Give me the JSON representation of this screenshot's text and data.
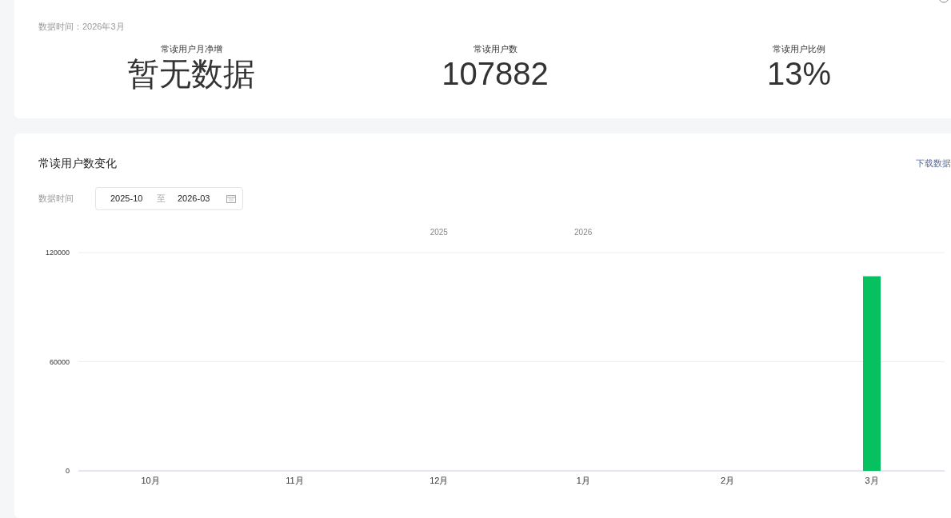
{
  "summary_card": {
    "data_time": "数据时间：2026年3月",
    "metrics": [
      {
        "label": "常读用户月净增",
        "value": "暂无数据"
      },
      {
        "label": "常读用户数",
        "value": "107882"
      },
      {
        "label": "常读用户比例",
        "value": "13%"
      }
    ]
  },
  "trend_card": {
    "title": "常读用户数变化",
    "download_link": "下载数据",
    "date_label": "数据时间",
    "date_start": "2025-10",
    "date_separator": "至",
    "date_end": "2026-03",
    "chart_data": {
      "type": "bar",
      "categories": [
        "10月",
        "11月",
        "12月",
        "1月",
        "2月",
        "3月"
      ],
      "values": [
        null,
        null,
        null,
        null,
        null,
        107000
      ],
      "ylim": [
        0,
        120000
      ],
      "yticks": [
        0,
        60000,
        120000
      ],
      "annotations": [
        "2025",
        "2026"
      ]
    }
  }
}
